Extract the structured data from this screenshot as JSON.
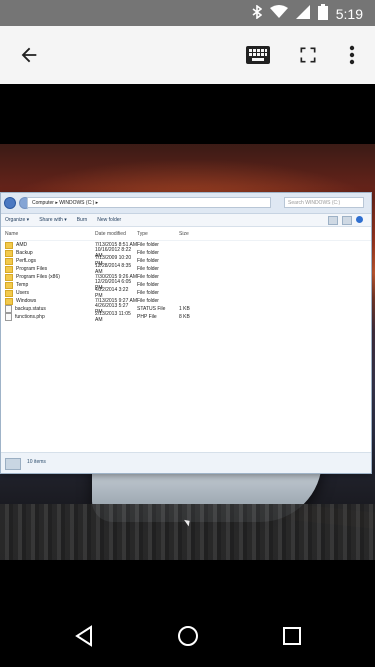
{
  "status_bar": {
    "time": "5:19",
    "icons": [
      "bluetooth-icon",
      "wifi-icon",
      "signal-icon",
      "battery-icon"
    ]
  },
  "app_bar": {
    "buttons": [
      "back-arrow-icon",
      "keyboard-icon",
      "fullscreen-icon",
      "more-vert-icon"
    ]
  },
  "explorer": {
    "path": "Computer ▸ WINDOWS (C:) ▸",
    "search_placeholder": "Search WINDOWS (C:)",
    "toolbar": {
      "organize": "Organize ▾",
      "share": "Share with ▾",
      "burn": "Burn",
      "new_folder": "New folder"
    },
    "columns": [
      "Name",
      "Date modified",
      "Type",
      "Size"
    ],
    "rows": [
      {
        "name": "AMD",
        "date": "7/13/2015 8:51 AM",
        "type": "File folder",
        "size": ""
      },
      {
        "name": "Backup",
        "date": "10/16/2012 8:22 AM",
        "type": "File folder",
        "size": ""
      },
      {
        "name": "PerfLogs",
        "date": "7/13/2009 10:20 PM",
        "type": "File folder",
        "size": ""
      },
      {
        "name": "Program Files",
        "date": "12/28/2014 8:35 AM",
        "type": "File folder",
        "size": ""
      },
      {
        "name": "Program Files (x86)",
        "date": "7/30/2015 9:26 AM",
        "type": "File folder",
        "size": ""
      },
      {
        "name": "Temp",
        "date": "12/20/2014 6:05 PM",
        "type": "File folder",
        "size": ""
      },
      {
        "name": "Users",
        "date": "4/22/2014 3:22 PM",
        "type": "File folder",
        "size": ""
      },
      {
        "name": "Windows",
        "date": "7/13/2015 9:27 AM",
        "type": "File folder",
        "size": ""
      },
      {
        "name": "backup.status",
        "date": "4/26/2013 5:27 PM",
        "type": "STATUS File",
        "size": "1 KB"
      },
      {
        "name": "functions.php",
        "date": "2/13/2013 11:05 AM",
        "type": "PHP File",
        "size": "8 KB"
      }
    ],
    "status_text": "10 items"
  },
  "nav_bar": {
    "buttons": [
      "back-triangle-icon",
      "home-circle-icon",
      "recents-square-icon"
    ]
  }
}
